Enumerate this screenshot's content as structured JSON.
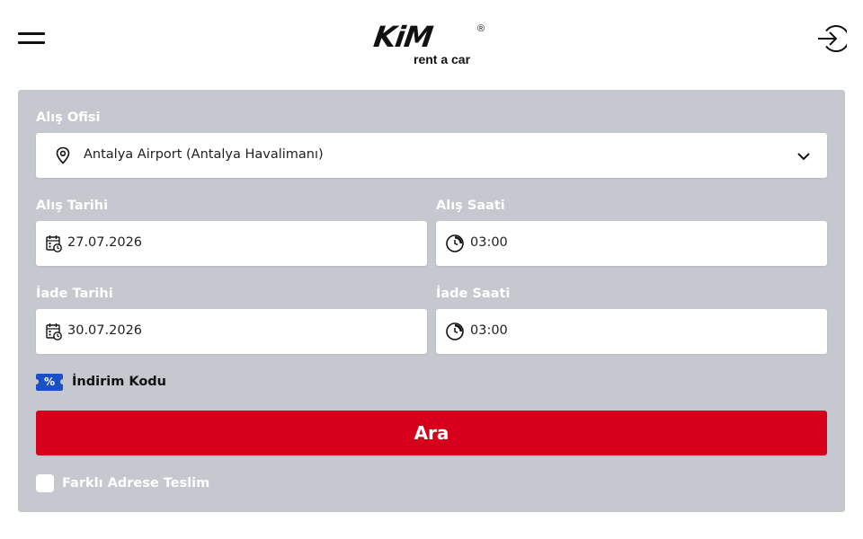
{
  "brand": {
    "name": "KiM",
    "registered": "®",
    "tagline": "rent a car"
  },
  "header": {
    "menu_icon": "hamburger-menu-icon",
    "login_icon": "login-arrow-icon"
  },
  "form": {
    "pickup_office": {
      "label": "Alış Ofisi",
      "value": "Antalya Airport (Antalya Havalimanı)",
      "icon": "location-pin-icon"
    },
    "pickup_date": {
      "label": "Alış Tarihi",
      "value": "27.07.2026",
      "icon": "calendar-clock-icon"
    },
    "pickup_time": {
      "label": "Alış Saati",
      "value": "03:00",
      "icon": "clock-icon"
    },
    "return_date": {
      "label": "İade Tarihi",
      "value": "30.07.2026",
      "icon": "calendar-clock-icon"
    },
    "return_time": {
      "label": "İade Saati",
      "value": "03:00",
      "icon": "clock-icon"
    },
    "promo": {
      "badge": "%",
      "label": "İndirim Kodu"
    },
    "search_button": "Ara",
    "different_address": {
      "label": "Farklı Adrese Teslim",
      "checked": false
    }
  },
  "colors": {
    "panel": "#c5c8cf",
    "primary": "#d6001c",
    "promo_badge": "#1a4fc8"
  }
}
